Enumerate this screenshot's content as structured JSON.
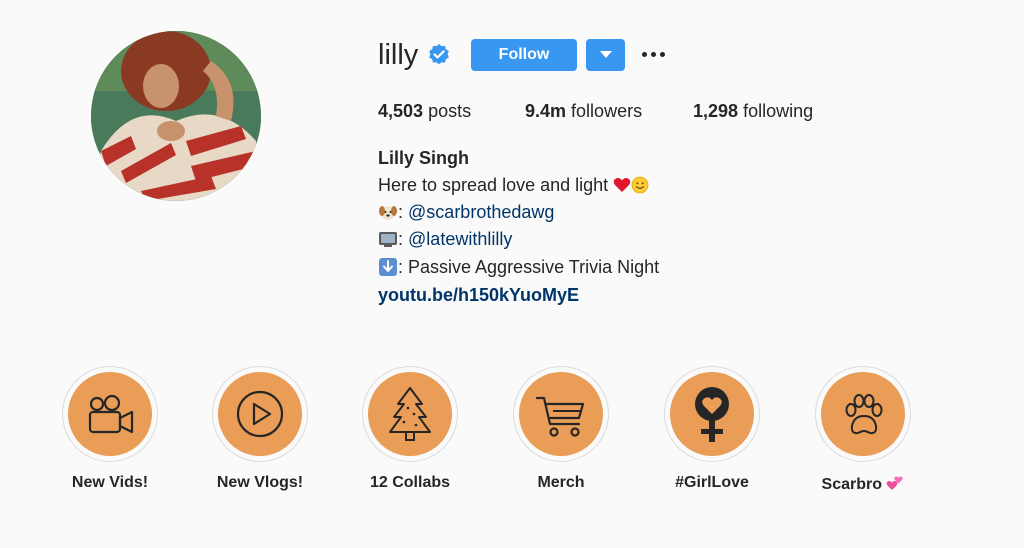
{
  "profile": {
    "username": "lilly",
    "verified": true,
    "follow_label": "Follow",
    "stats": {
      "posts_count": "4,503",
      "posts_label": "posts",
      "followers_count": "9.4m",
      "followers_label": "followers",
      "following_count": "1,298",
      "following_label": "following"
    },
    "bio": {
      "name": "Lilly Singh",
      "line1": "Here to spread love and light",
      "line1_emojis": [
        "red-heart",
        "smiling-face"
      ],
      "line2_emoji": "dog-face",
      "line2_prefix": ":",
      "line2_mention": "@scarbrothedawg",
      "line3_emoji": "television",
      "line3_prefix": ":",
      "line3_mention": "@latewithlilly",
      "line4_emoji": "down-arrow",
      "line4_text": ": Passive Aggressive Trivia Night",
      "link": "youtu.be/h150kYuoMyE"
    }
  },
  "highlights": [
    {
      "label": "New Vids!",
      "icon": "video-camera-icon"
    },
    {
      "label": "New Vlogs!",
      "icon": "play-circle-icon"
    },
    {
      "label": "12 Collabs",
      "icon": "christmas-tree-icon"
    },
    {
      "label": "Merch",
      "icon": "shopping-cart-icon"
    },
    {
      "label": "#GirlLove",
      "icon": "female-heart-icon"
    },
    {
      "label": "Scarbro",
      "icon": "paw-print-icon",
      "suffix_emoji": "two-hearts"
    }
  ],
  "colors": {
    "background": "#fafafa",
    "accent_blue": "#3897f0",
    "verified_blue": "#3897f0",
    "link_blue": "#003569",
    "highlight_orange": "#e99d57",
    "text": "#262626"
  }
}
